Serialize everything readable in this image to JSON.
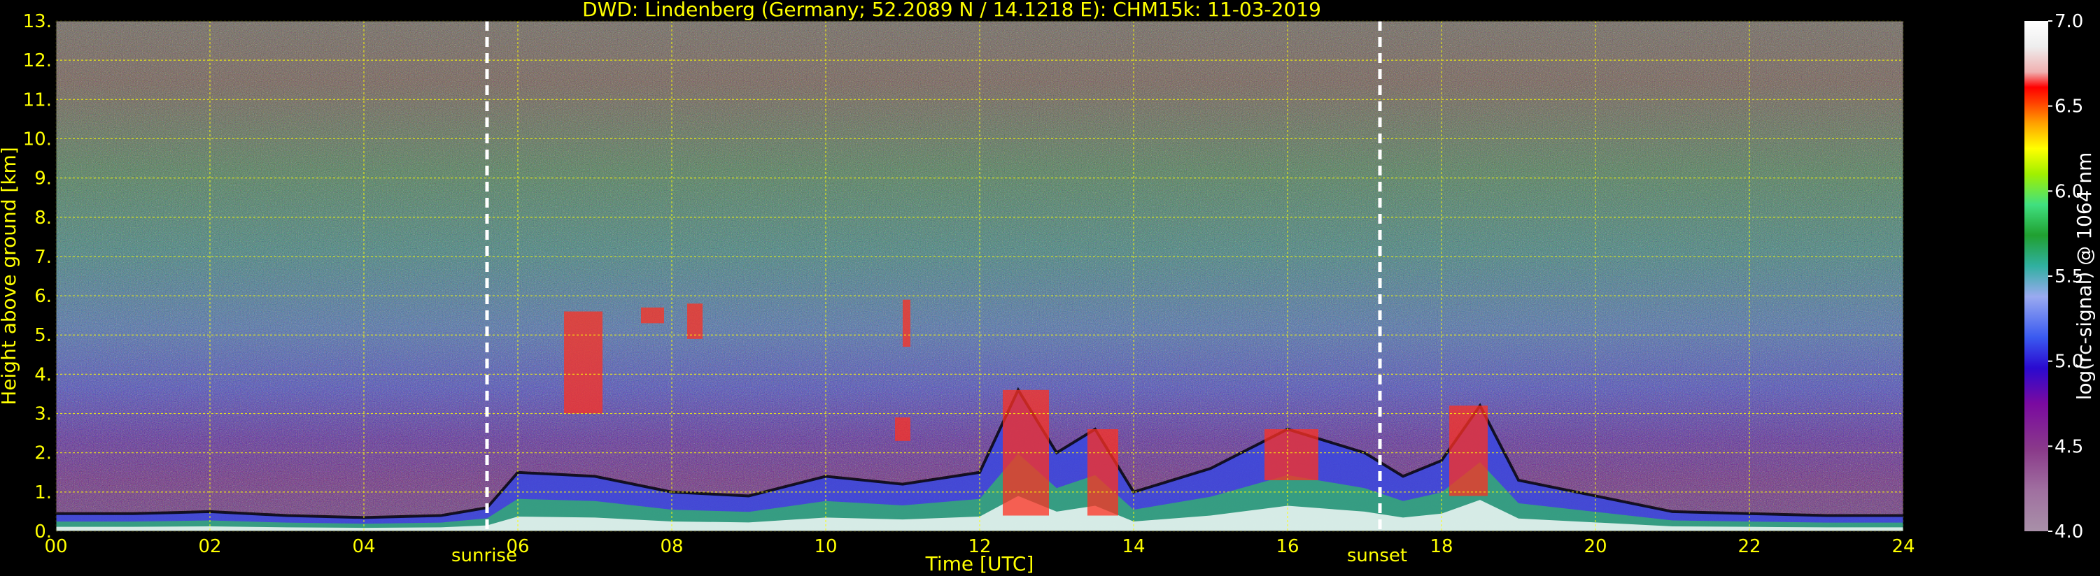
{
  "chart_data": {
    "type": "heatmap",
    "title": "DWD: Lindenberg (Germany; 52.2089 N / 14.1218 E):    CHM15k: 11-03-2019",
    "xlabel": "Time [UTC]",
    "ylabel": "Height above ground [km]",
    "xlim": [
      0,
      24
    ],
    "ylim": [
      0,
      13
    ],
    "x_ticks": [
      "00",
      "02",
      "04",
      "06",
      "08",
      "10",
      "12",
      "14",
      "16",
      "18",
      "20",
      "22",
      "24"
    ],
    "y_ticks": [
      "0.",
      "1.",
      "2.",
      "3.",
      "4.",
      "5.",
      "6.",
      "7.",
      "8.",
      "9.",
      "10.",
      "11.",
      "12.",
      "13."
    ],
    "grid": true,
    "markers": [
      {
        "label": "sunrise",
        "x": 5.6
      },
      {
        "label": "sunset",
        "x": 17.2
      }
    ],
    "colorbar": {
      "label": "log(rc-signal) @ 1064 nm",
      "range": [
        4.0,
        7.0
      ],
      "ticks": [
        "4.0",
        "4.5",
        "5.0",
        "5.5",
        "6.0",
        "6.5",
        "7.0"
      ]
    },
    "boundary_layer_top_km": [
      [
        0,
        0.45
      ],
      [
        1,
        0.45
      ],
      [
        2,
        0.5
      ],
      [
        3,
        0.4
      ],
      [
        4,
        0.35
      ],
      [
        5,
        0.4
      ],
      [
        5.6,
        0.6
      ],
      [
        6,
        1.5
      ],
      [
        7,
        1.4
      ],
      [
        8,
        1.0
      ],
      [
        9,
        0.9
      ],
      [
        10,
        1.4
      ],
      [
        11,
        1.2
      ],
      [
        12,
        1.5
      ],
      [
        12.5,
        3.6
      ],
      [
        13,
        2.0
      ],
      [
        13.5,
        2.6
      ],
      [
        14,
        1.0
      ],
      [
        15,
        1.6
      ],
      [
        16,
        2.6
      ],
      [
        17,
        2.0
      ],
      [
        17.5,
        1.4
      ],
      [
        18,
        1.8
      ],
      [
        18.5,
        3.2
      ],
      [
        19,
        1.3
      ],
      [
        20,
        0.9
      ],
      [
        21,
        0.5
      ],
      [
        22,
        0.45
      ],
      [
        23,
        0.4
      ],
      [
        24,
        0.4
      ]
    ],
    "cloud_features": [
      {
        "x": [
          6.6,
          7.1
        ],
        "y": [
          3.0,
          5.6
        ]
      },
      {
        "x": [
          7.6,
          7.9
        ],
        "y": [
          5.3,
          5.7
        ]
      },
      {
        "x": [
          8.2,
          8.4
        ],
        "y": [
          4.9,
          5.8
        ]
      },
      {
        "x": [
          11.0,
          11.1
        ],
        "y": [
          4.7,
          5.9
        ]
      },
      {
        "x": [
          10.9,
          11.1
        ],
        "y": [
          2.3,
          2.9
        ]
      },
      {
        "x": [
          12.3,
          12.9
        ],
        "y": [
          0.4,
          3.6
        ]
      },
      {
        "x": [
          13.4,
          13.8
        ],
        "y": [
          0.4,
          2.6
        ]
      },
      {
        "x": [
          15.7,
          16.4
        ],
        "y": [
          1.3,
          2.6
        ]
      },
      {
        "x": [
          18.1,
          18.6
        ],
        "y": [
          0.9,
          3.2
        ]
      }
    ]
  }
}
